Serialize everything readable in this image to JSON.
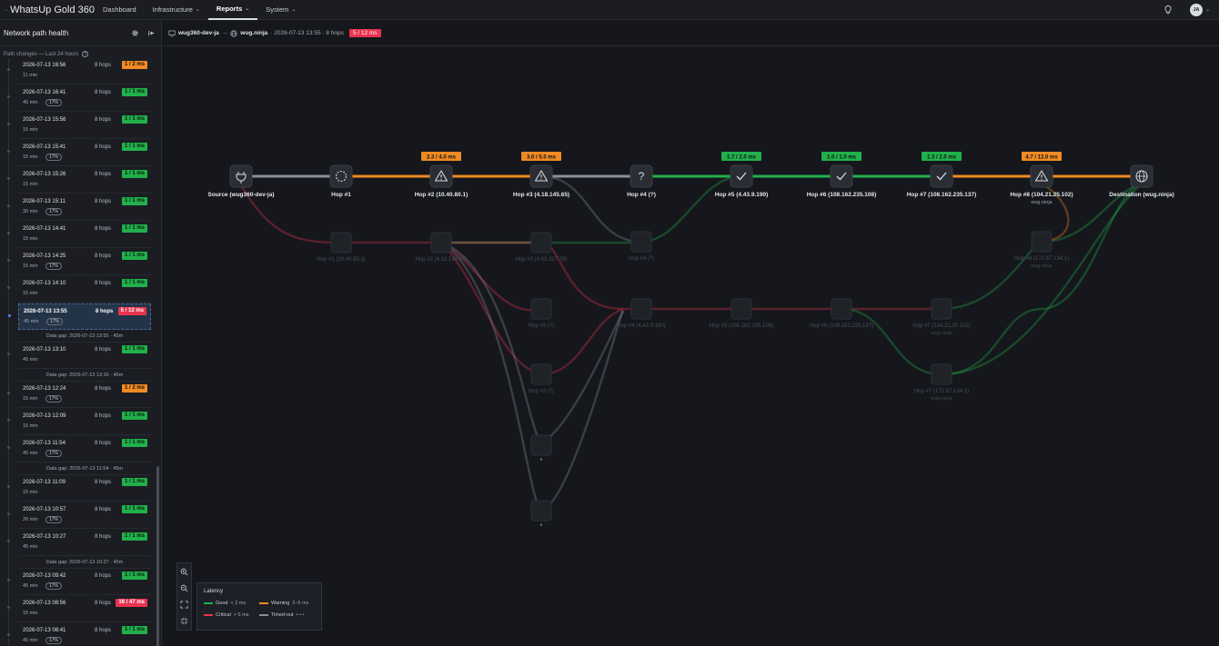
{
  "app": {
    "name": "WhatsUp Gold 360"
  },
  "nav": {
    "dashboard": "Dashboard",
    "infrastructure": "Infrastructure",
    "reports": "Reports",
    "system": "System",
    "user_initials": "JA"
  },
  "sidebar": {
    "title": "Network path health",
    "subtitle": "Path changes — Last 24 hours",
    "entries": [
      {
        "date": "2026-07-13 16:56",
        "hops": "8 hops",
        "dur": "11 min",
        "pct": "",
        "badge": "1 / 2 ms",
        "status": "warn"
      },
      {
        "date": "2026-07-13 16:41",
        "hops": "8 hops",
        "dur": "45 min",
        "pct": "17%",
        "badge": "1 / 1 ms",
        "status": "good"
      },
      {
        "date": "2026-07-13 15:56",
        "hops": "8 hops",
        "dur": "15 min",
        "pct": "",
        "badge": "1 / 1 ms",
        "status": "good"
      },
      {
        "date": "2026-07-13 15:41",
        "hops": "8 hops",
        "dur": "15 min",
        "pct": "17%",
        "badge": "1 / 1 ms",
        "status": "good"
      },
      {
        "date": "2026-07-13 15:26",
        "hops": "8 hops",
        "dur": "15 min",
        "pct": "",
        "badge": "1 / 1 ms",
        "status": "good"
      },
      {
        "date": "2026-07-13 15:11",
        "hops": "8 hops",
        "dur": "30 min",
        "pct": "17%",
        "badge": "1 / 1 ms",
        "status": "good"
      },
      {
        "date": "2026-07-13 14:41",
        "hops": "8 hops",
        "dur": "15 min",
        "pct": "",
        "badge": "1 / 1 ms",
        "status": "good"
      },
      {
        "date": "2026-07-13 14:25",
        "hops": "8 hops",
        "dur": "15 min",
        "pct": "17%",
        "badge": "1 / 1 ms",
        "status": "good"
      },
      {
        "date": "2026-07-13 14:10",
        "hops": "8 hops",
        "dur": "15 min",
        "pct": "",
        "badge": "1 / 1 ms",
        "status": "good"
      },
      {
        "date": "2026-07-13 13:55",
        "hops": "8 hops",
        "dur": "45 min",
        "pct": "17%",
        "badge": "5 / 12 ms",
        "status": "crit",
        "selected": true
      },
      {
        "gap": "Data gap: 2026-07-13 13:55 · 45m"
      },
      {
        "date": "2026-07-13 13:10",
        "hops": "8 hops",
        "dur": "45 min",
        "pct": "",
        "badge": "1 / 1 ms",
        "status": "good"
      },
      {
        "gap": "Data gap: 2026-07-13 13:10 · 45m"
      },
      {
        "date": "2026-07-13 12:24",
        "hops": "8 hops",
        "dur": "15 min",
        "pct": "17%",
        "badge": "1 / 2 ms",
        "status": "warn"
      },
      {
        "date": "2026-07-13 12:09",
        "hops": "8 hops",
        "dur": "15 min",
        "pct": "",
        "badge": "1 / 1 ms",
        "status": "good"
      },
      {
        "date": "2026-07-13 11:54",
        "hops": "8 hops",
        "dur": "45 min",
        "pct": "17%",
        "badge": "1 / 1 ms",
        "status": "good"
      },
      {
        "gap": "Data gap: 2026-07-13 11:54 · 45m"
      },
      {
        "date": "2026-07-13 11:09",
        "hops": "8 hops",
        "dur": "15 min",
        "pct": "",
        "badge": "1 / 1 ms",
        "status": "good"
      },
      {
        "date": "2026-07-13 10:57",
        "hops": "8 hops",
        "dur": "26 min",
        "pct": "17%",
        "badge": "1 / 1 ms",
        "status": "good"
      },
      {
        "date": "2026-07-13 10:27",
        "hops": "8 hops",
        "dur": "45 min",
        "pct": "",
        "badge": "1 / 1 ms",
        "status": "good"
      },
      {
        "gap": "Data gap: 2026-07-13 10:27 · 45m"
      },
      {
        "date": "2026-07-13 09:42",
        "hops": "8 hops",
        "dur": "45 min",
        "pct": "17%",
        "badge": "1 / 1 ms",
        "status": "good"
      },
      {
        "date": "2026-07-13 08:56",
        "hops": "8 hops",
        "dur": "15 min",
        "pct": "",
        "badge": "16 / 47 ms",
        "status": "crit"
      },
      {
        "date": "2026-07-13 08:41",
        "hops": "8 hops",
        "dur": "45 min",
        "pct": "17%",
        "badge": "1 / 1 ms",
        "status": "good"
      }
    ]
  },
  "breadcrumb": {
    "source": "wug360-dev-ja",
    "dest": "wug.ninja",
    "meta": "· 2026-07-13 13:55 · 8 hops",
    "badge": "5 / 12 ms"
  },
  "path": {
    "nodes": [
      {
        "label": "Source (wug360-dev-ja)",
        "icon": "plug-icon",
        "badge": "",
        "status": ""
      },
      {
        "label": "Hop #1",
        "icon": "timeout-icon",
        "badge": "",
        "status": ""
      },
      {
        "label": "Hop #2 (10.40.80.1)",
        "icon": "warning-icon",
        "badge": "2.3 / 4.0 ms",
        "status": "warn"
      },
      {
        "label": "Hop #3 (4.18.145.65)",
        "icon": "warning-icon",
        "badge": "3.0 / 5.0 ms",
        "status": "warn"
      },
      {
        "label": "Hop #4 (?)",
        "icon": "question-icon",
        "badge": "",
        "status": ""
      },
      {
        "label": "Hop #5 (4.43.9.190)",
        "icon": "check-icon",
        "badge": "1.7 / 2.0 ms",
        "status": "good"
      },
      {
        "label": "Hop #6 (108.162.235.108)",
        "icon": "check-icon",
        "badge": "1.0 / 1.0 ms",
        "status": "good"
      },
      {
        "label": "Hop #7 (108.162.235.137)",
        "icon": "check-icon",
        "badge": "1.3 / 2.0 ms",
        "status": "good"
      },
      {
        "label": "Hop #8 (104.21.25.102)",
        "icon": "warning-icon",
        "badge": "4.7 / 12.0 ms",
        "status": "warn",
        "sublabel": "wug.ninja"
      },
      {
        "label": "Destination (wug.ninja)",
        "icon": "globe-icon",
        "badge": "",
        "status": ""
      }
    ],
    "ghost_nodes": [
      {
        "label": "Hop #1 (10.40.80.1)",
        "sublabel": ""
      },
      {
        "label": "Hop #2 (4.18.145.65)",
        "sublabel": ""
      },
      {
        "label": "Hop #3 (4.69.327.78)",
        "sublabel": ""
      },
      {
        "label": "Hop #4 (?)",
        "sublabel": ""
      },
      {
        "label": "Hop #8 (172.67.134.1)",
        "sublabel": "wug.ninja"
      },
      {
        "label": "Hop #3 (?)",
        "sublabel": ""
      },
      {
        "label": "Hop #4 (4.43.9.190)",
        "sublabel": ""
      },
      {
        "label": "Hop #5 (108.162.235.108)",
        "sublabel": ""
      },
      {
        "label": "Hop #6 (108.162.235.137)",
        "sublabel": ""
      },
      {
        "label": "Hop #7 (104.21.25.102)",
        "sublabel": "wug.ninja"
      },
      {
        "label": "Hop #3 (?)",
        "sublabel": ""
      },
      {
        "label": "Hop #7 (172.67.134.1)",
        "sublabel": "wug.ninja"
      },
      {
        "label": "•",
        "sublabel": ""
      },
      {
        "label": "•",
        "sublabel": ""
      }
    ]
  },
  "legend": {
    "title": "Latency",
    "good": "Good",
    "good_range": "< 2 ms",
    "warn": "Warning",
    "warn_range": "2–5 ms",
    "crit": "Critical",
    "crit_range": "> 5 ms",
    "timeout": "Timed-out",
    "timeout_range": "• • •"
  },
  "colors": {
    "good": "#21b04b",
    "warn": "#f08a24",
    "crit": "#e8334f",
    "timeout": "#8a9098"
  }
}
